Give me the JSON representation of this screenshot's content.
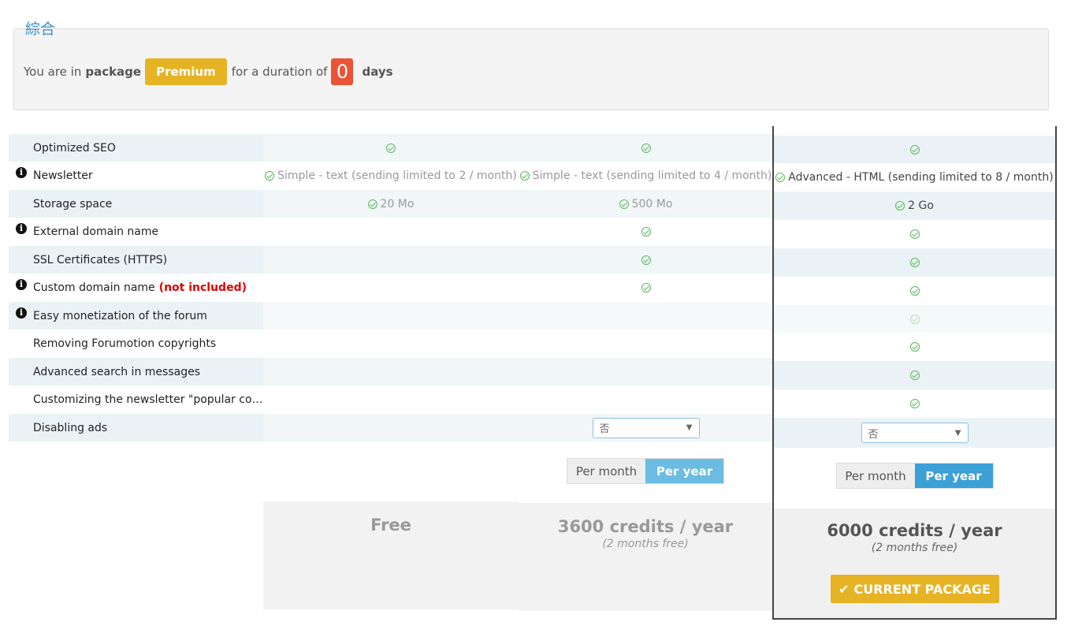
{
  "header": {
    "legend": "綜合",
    "you_are_in": "You are in",
    "package_word": "package",
    "package_name": "Premium",
    "for_duration": "for a duration of",
    "days_value": "0",
    "days_word": "days"
  },
  "features": [
    {
      "label": "Optimized SEO",
      "info": false
    },
    {
      "label": "Newsletter",
      "info": true
    },
    {
      "label": "Storage space",
      "info": false
    },
    {
      "label": "External domain name",
      "info": true
    },
    {
      "label": "SSL Certificates (HTTPS)",
      "info": false
    },
    {
      "label": "Custom domain name",
      "info": true,
      "note": "(not included)"
    },
    {
      "label": "Easy monetization of the forum",
      "info": true
    },
    {
      "label": "Removing Forumotion copyrights",
      "info": false
    },
    {
      "label": "Advanced search in messages",
      "info": false
    },
    {
      "label": "Customizing the newsletter \"popular cont...",
      "info": false
    },
    {
      "label": "Disabling ads",
      "info": false
    }
  ],
  "plans": {
    "free": {
      "newsletter": "Simple - text (sending limited to 2 / month)",
      "storage": "20 Mo",
      "price": "Free"
    },
    "mid": {
      "newsletter": "Simple - text (sending limited to 4 / month)",
      "storage": "500 Mo",
      "disable_ads_value": "否",
      "toggle_month": "Per month",
      "toggle_year": "Per year",
      "price": "3600 credits / year",
      "price_note": "(2 months free)"
    },
    "premium": {
      "newsletter": "Advanced - HTML (sending limited to 8 / month)",
      "storage": "2 Go",
      "disable_ads_value": "否",
      "toggle_month": "Per month",
      "toggle_year": "Per year",
      "price": "6000 credits / year",
      "price_note": "(2 months free)",
      "current_button": "CURRENT PACKAGE"
    }
  },
  "colors": {
    "premium_badge": "#e6b325",
    "days_badge": "#e95337",
    "legend": "#3a8fc8",
    "check": "#5cb85c",
    "toggle_active": "#3aa0d6",
    "not_included": "#e00000"
  }
}
